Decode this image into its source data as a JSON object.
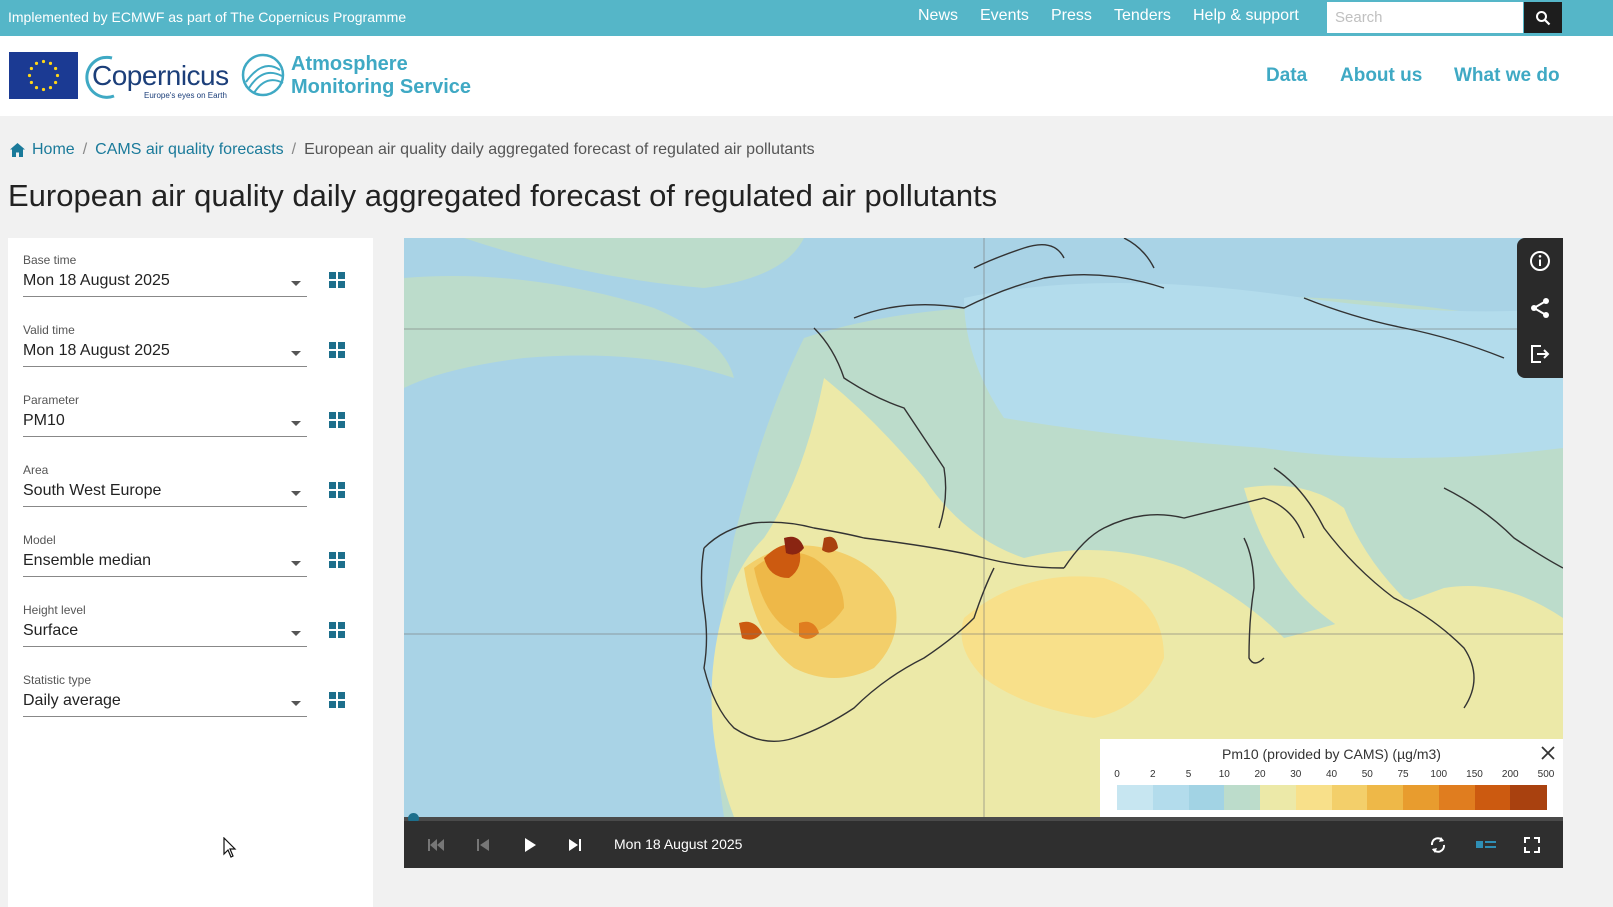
{
  "topbar": {
    "implemented_by": "Implemented by ECMWF as part of The Copernicus Programme",
    "nav": [
      "News",
      "Events",
      "Press",
      "Tenders",
      "Help & support"
    ],
    "search_placeholder": "Search"
  },
  "header": {
    "copernicus_logo_text": "Copernicus",
    "copernicus_tagline": "Europe's eyes on Earth",
    "cams_title_line1": "Atmosphere",
    "cams_title_line2": "Monitoring Service",
    "main_nav": [
      "Data",
      "About us",
      "What we do"
    ]
  },
  "breadcrumb": {
    "home": "Home",
    "parent": "CAMS air quality forecasts",
    "current": "European air quality daily aggregated forecast of regulated air pollutants"
  },
  "page_title": "European air quality daily aggregated forecast of regulated air pollutants",
  "controls_panel": {
    "fields": [
      {
        "label": "Base time",
        "value": "Mon 18 August 2025"
      },
      {
        "label": "Valid time",
        "value": "Mon 18 August 2025"
      },
      {
        "label": "Parameter",
        "value": "PM10"
      },
      {
        "label": "Area",
        "value": "South West Europe"
      },
      {
        "label": "Model",
        "value": "Ensemble median"
      },
      {
        "label": "Height level",
        "value": "Surface"
      },
      {
        "label": "Statistic type",
        "value": "Daily average"
      }
    ]
  },
  "map": {
    "legend": {
      "title": "Pm10 (provided by CAMS) (µg/m3)",
      "ticks": [
        "0",
        "2",
        "5",
        "10",
        "20",
        "30",
        "40",
        "50",
        "75",
        "100",
        "150",
        "200",
        "500"
      ],
      "colors": [
        "#c7e6f1",
        "#b3dcec",
        "#a2d3e4",
        "#bcdccb",
        "#ece9a8",
        "#f8e08a",
        "#f3cf6a",
        "#eeb848",
        "#e89c2e",
        "#e07d1f",
        "#cc5a10",
        "#a9410f",
        "#8a2512"
      ]
    },
    "sea_color": "#a9d3e6",
    "land_low_color": "#c0dfc9",
    "playback": {
      "date": "Mon 18 August 2025",
      "position_fraction": 0.0
    }
  },
  "colors": {
    "topbar": "#55b6c8",
    "accent": "#3fa9c4",
    "link": "#1a7a9a"
  }
}
